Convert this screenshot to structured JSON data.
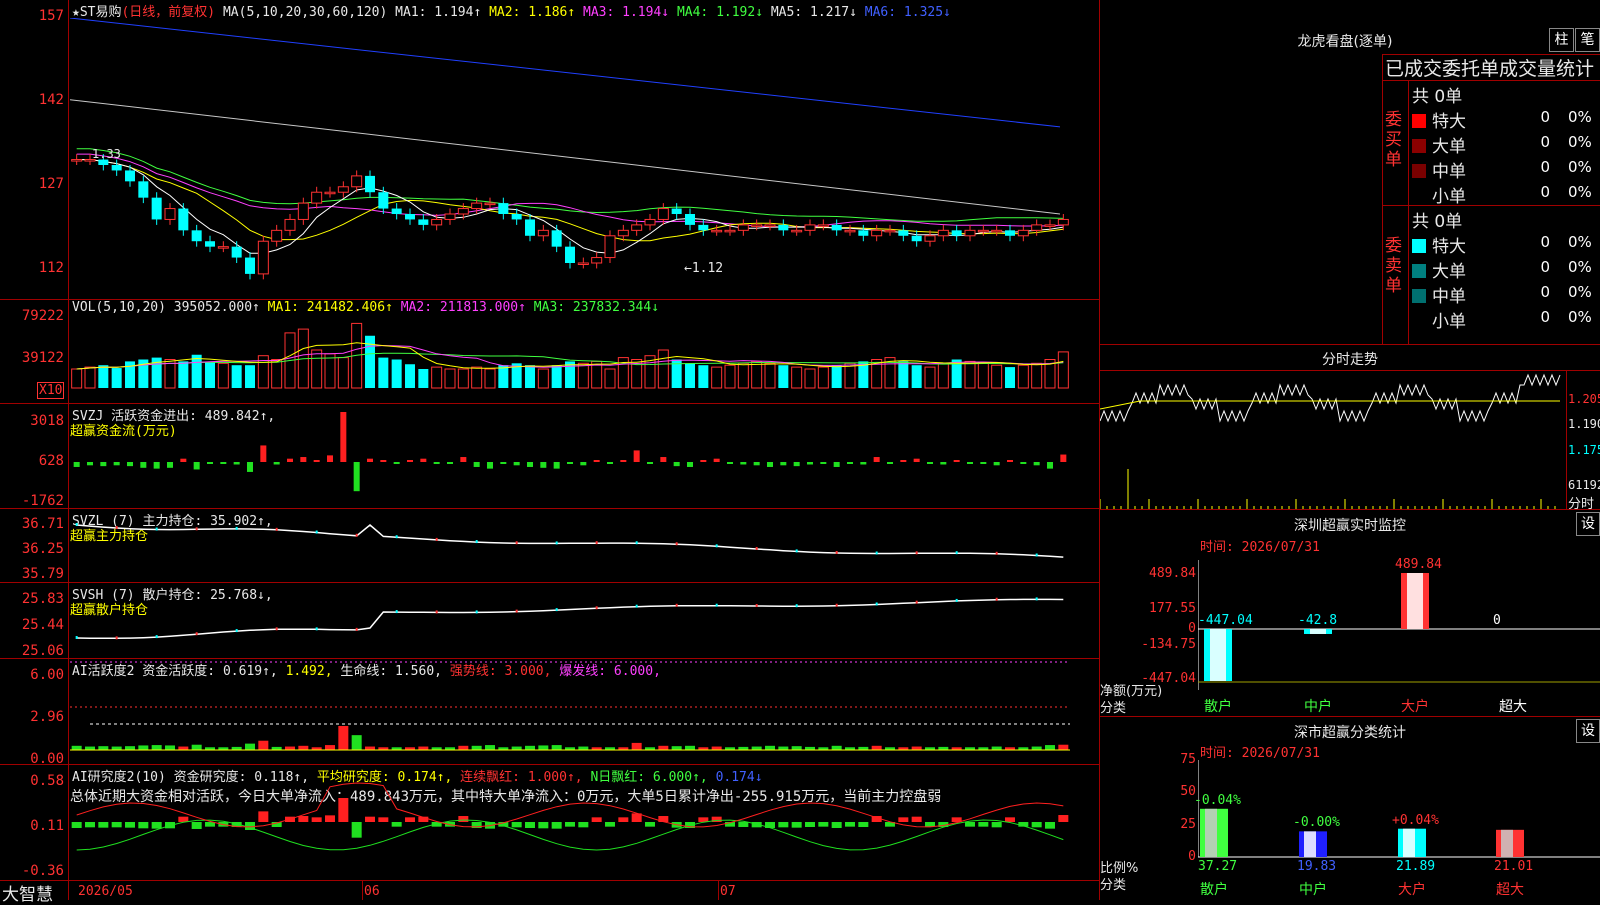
{
  "app": {
    "brand": "大智慧"
  },
  "kline": {
    "header_prefix": "★ST易购",
    "header_mode": "(日线，前复权)",
    "ma_label": "MA(5,10,20,30,60,120)",
    "ma1": "MA1: 1.194↑",
    "ma2": "MA2: 1.186↑",
    "ma3": "MA3: 1.194↓",
    "ma4": "MA4: 1.192↓",
    "ma5": "MA5: 1.217↓",
    "ma6": "MA6: 1.325↓",
    "yticks": [
      "157",
      "142",
      "127",
      "112"
    ],
    "low_label": "←1.12",
    "left_label": "1.33",
    "closes": [
      1.31,
      1.31,
      1.3,
      1.29,
      1.27,
      1.24,
      1.2,
      1.22,
      1.18,
      1.16,
      1.15,
      1.15,
      1.13,
      1.1,
      1.16,
      1.18,
      1.2,
      1.23,
      1.25,
      1.25,
      1.26,
      1.28,
      1.25,
      1.22,
      1.21,
      1.2,
      1.19,
      1.2,
      1.21,
      1.22,
      1.23,
      1.23,
      1.21,
      1.2,
      1.17,
      1.18,
      1.15,
      1.12,
      1.12,
      1.13,
      1.17,
      1.18,
      1.19,
      1.2,
      1.22,
      1.21,
      1.19,
      1.18,
      1.18,
      1.18,
      1.19,
      1.19,
      1.19,
      1.18,
      1.18,
      1.19,
      1.19,
      1.18,
      1.18,
      1.17,
      1.18,
      1.18,
      1.17,
      1.16,
      1.17,
      1.18,
      1.17,
      1.18,
      1.18,
      1.18,
      1.17,
      1.18,
      1.19,
      1.19,
      1.2
    ]
  },
  "vol": {
    "header": "VOL(5,10,20)",
    "value": "395052.000↑",
    "ma1": "MA1: 241482.406↑",
    "ma2": "MA2: 211813.000↑",
    "ma3": "MA3: 237832.344↓",
    "yticks": [
      "79222",
      "39122"
    ],
    "unit": "X10",
    "values": [
      20,
      22,
      24,
      21,
      28,
      30,
      32,
      30,
      28,
      35,
      27,
      26,
      24,
      24,
      34,
      30,
      58,
      62,
      40,
      36,
      32,
      68,
      55,
      32,
      30,
      25,
      20,
      22,
      20,
      20,
      22,
      20,
      24,
      26,
      24,
      20,
      24,
      28,
      26,
      28,
      20,
      32,
      30,
      34,
      40,
      30,
      26,
      24,
      22,
      24,
      26,
      28,
      26,
      24,
      22,
      20,
      22,
      24,
      26,
      28,
      30,
      32,
      28,
      24,
      22,
      26,
      30,
      28,
      26,
      24,
      22,
      24,
      26,
      30,
      38
    ]
  },
  "svzj": {
    "header": "SVZJ  活跃资金进出: 489.842↑,",
    "subtitle": "超赢资金流(万元)",
    "yticks": [
      "3018",
      "628",
      "-1762"
    ],
    "values": [
      -300,
      -200,
      -250,
      -200,
      -250,
      -350,
      -400,
      -350,
      200,
      -450,
      -100,
      -100,
      -150,
      -600,
      1000,
      -150,
      200,
      300,
      100,
      400,
      3018,
      -1762,
      200,
      100,
      -100,
      100,
      200,
      -100,
      -100,
      300,
      -300,
      -400,
      -100,
      -200,
      -300,
      -350,
      -400,
      -100,
      -200,
      100,
      -100,
      100,
      700,
      -100,
      300,
      -250,
      -300,
      100,
      200,
      -100,
      -150,
      -200,
      -300,
      -200,
      -250,
      -150,
      -100,
      -300,
      -100,
      -150,
      300,
      -100,
      100,
      200,
      -100,
      -150,
      100,
      -100,
      -100,
      -200,
      100,
      -100,
      -200,
      -400,
      450
    ]
  },
  "svzl": {
    "header": "SVZL (7) 主力持仓: 35.902↑,",
    "subtitle": "超赢主力持仓",
    "yticks": [
      "36.71",
      "36.25",
      "35.79"
    ]
  },
  "svsh": {
    "header": "SVSH (7) 散户持仓: 25.768↓,",
    "subtitle": "超赢散户持仓",
    "yticks": [
      "25.83",
      "25.44",
      "25.06"
    ]
  },
  "ai1": {
    "header1": "AI活跃度2 资金活跃度: 0.619↑,",
    "header2": "1.492,",
    "header3": "生命线: 1.560,",
    "header4": "强势线: 3.000,",
    "header5": "爆发线: 6.000,",
    "yticks": [
      "6.00",
      "2.96",
      "0.00"
    ]
  },
  "ai2": {
    "header1": "AI研究度2(10) 资金研究度: 0.118↑,",
    "header2": "平均研究度: 0.174↑,",
    "header3": "连续飘红: 1.000↑,",
    "header4": "N日飘红: 6.000↑,",
    "header5": "0.174↓",
    "summary": "总体近期大资金相对活跃，今日大单净流入：489.843万元，其中特大单净流入：0万元，大单5日累计净出-255.915万元，当前主力控盘弱",
    "yticks": [
      "0.58",
      "0.11",
      "-0.36"
    ]
  },
  "dates": [
    "2026/05",
    "06",
    "07"
  ],
  "right": {
    "lhb_title": "龙虎看盘(逐单)",
    "btn1": "柱",
    "btn2": "笔",
    "stat_title": "已成交委托单成交量统计",
    "buy_side": "委买单",
    "sell_side": "委卖单",
    "buy_total": "共 0单",
    "sell_total": "共 0单",
    "buy_rows": [
      {
        "label": "特大",
        "val": "0",
        "pct": "0%",
        "color": "#ff0000"
      },
      {
        "label": "大单",
        "val": "0",
        "pct": "0%",
        "color": "#8b0000"
      },
      {
        "label": "中单",
        "val": "0",
        "pct": "0%",
        "color": "#7a0000"
      },
      {
        "label": "小单",
        "val": "0",
        "pct": "0%",
        "color": "#000000"
      }
    ],
    "sell_rows": [
      {
        "label": "特大",
        "val": "0",
        "pct": "0%",
        "color": "#00ffff"
      },
      {
        "label": "大单",
        "val": "0",
        "pct": "0%",
        "color": "#008080"
      },
      {
        "label": "中单",
        "val": "0",
        "pct": "0%",
        "color": "#007070"
      },
      {
        "label": "小单",
        "val": "0",
        "pct": "0%",
        "color": "#000000"
      }
    ],
    "fs_title": "分时走势",
    "fs_ticks": [
      "1.205",
      "1.190",
      "1.175"
    ],
    "fs_vol_lbl": "61192",
    "fs_vol_unit": "分时",
    "sz_title": "深圳超赢实时监控",
    "sz_settings": "设",
    "sz_time": "时间: 2026/07/31",
    "sz_yticks": [
      "489.84",
      "177.55",
      "0",
      "-134.75",
      "-447.04"
    ],
    "sz_bars": [
      {
        "label": "散户",
        "value": "-447.04",
        "v": -447.04
      },
      {
        "label": "中户",
        "value": "-42.8",
        "v": -42.8
      },
      {
        "label": "大户",
        "value": "489.84",
        "v": 489.84
      },
      {
        "label": "超大",
        "value": "0",
        "v": 0
      }
    ],
    "sz_unit1": "净额(万元)",
    "sz_unit2": "分类",
    "cls_title": "深市超赢分类统计",
    "cls_settings": "设",
    "cls_time": "时间: 2026/07/31",
    "cls_yticks": [
      "75",
      "50",
      "25",
      "0"
    ],
    "cls_bars": [
      {
        "label": "散户",
        "top": "-0.04%",
        "bottom": "37.27",
        "v": 37.27
      },
      {
        "label": "中户",
        "top": "-0.00%",
        "bottom": "19.83",
        "v": 19.83
      },
      {
        "label": "大户",
        "top": "+0.04%",
        "bottom": "21.89",
        "v": 21.89
      },
      {
        "label": "超大",
        "top": "",
        "bottom": "21.01",
        "v": 21.01
      }
    ],
    "cls_unit1": "比例%",
    "cls_unit2": "分类"
  }
}
